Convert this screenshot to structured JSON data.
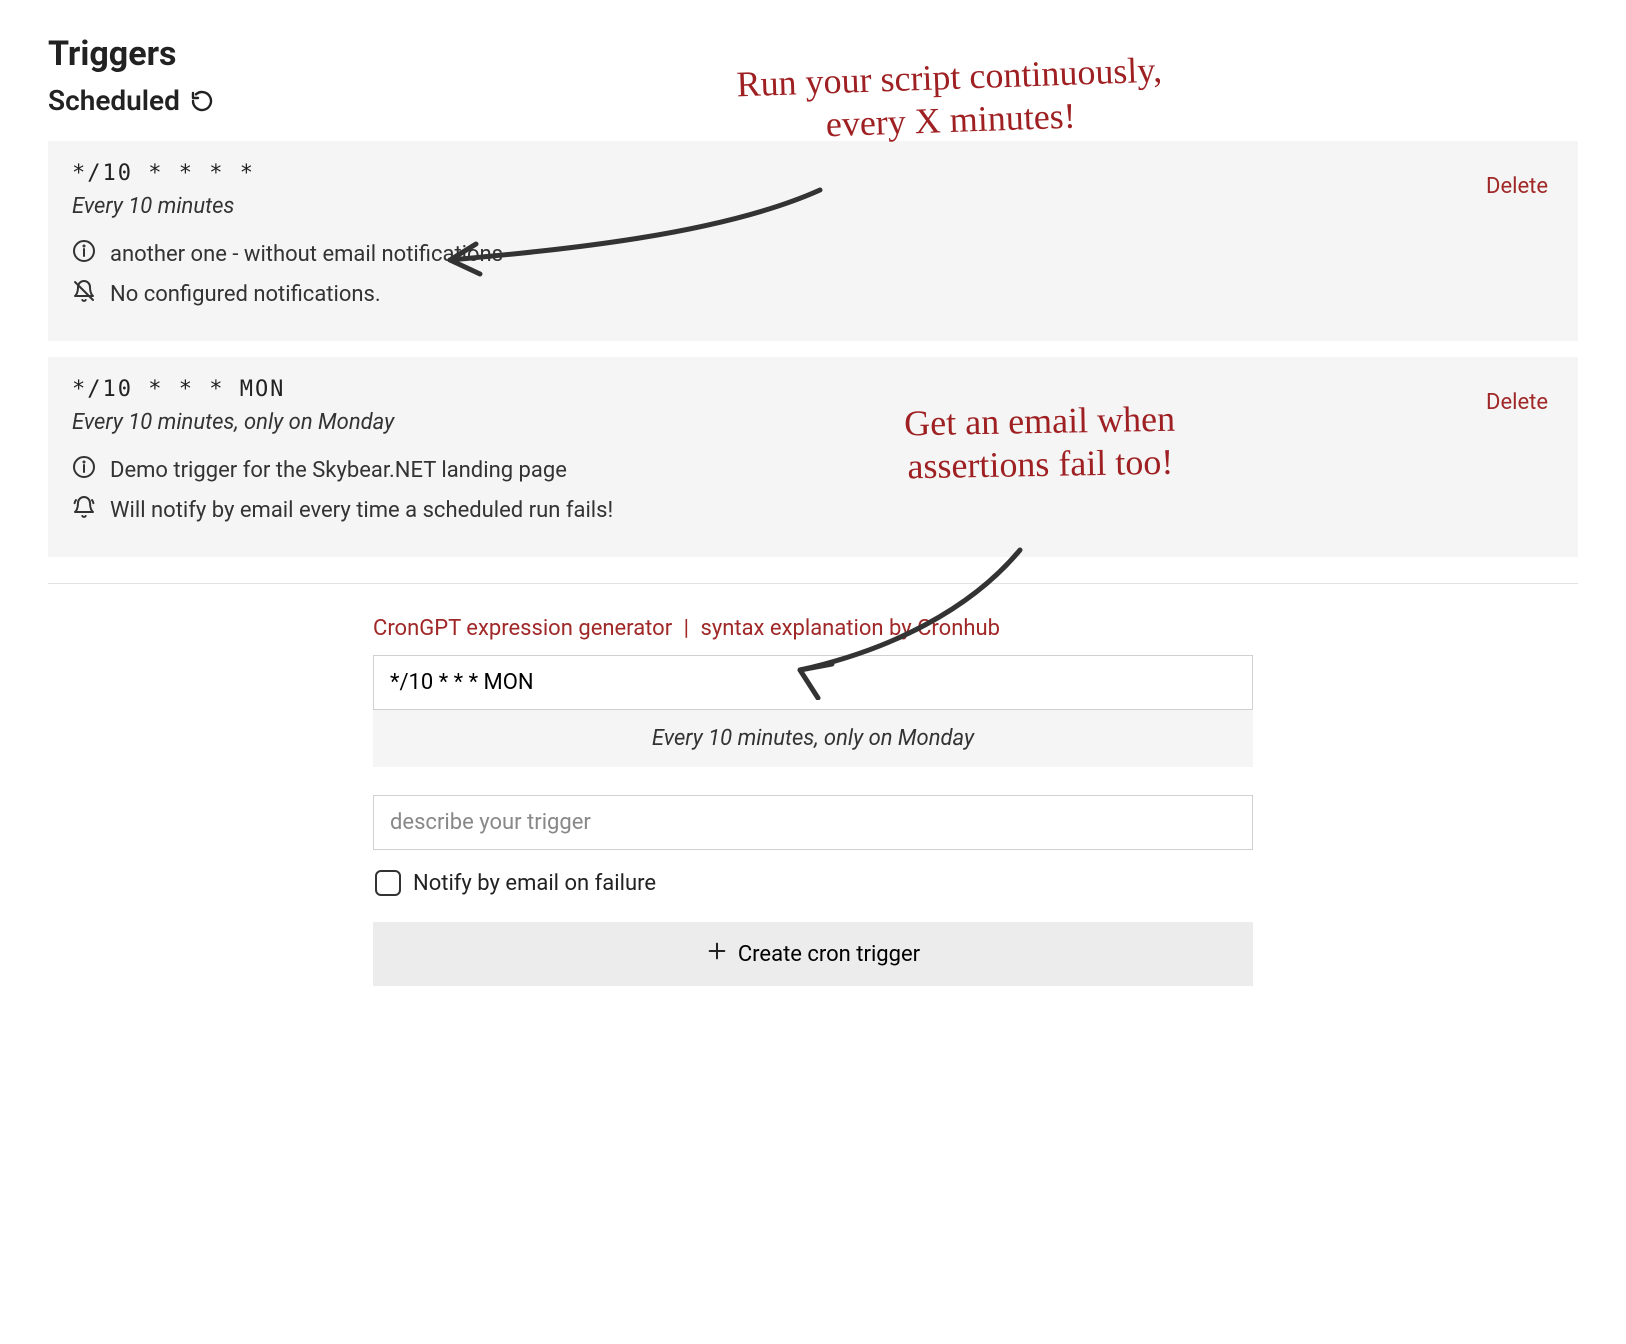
{
  "title": "Triggers",
  "section": {
    "heading": "Scheduled"
  },
  "triggers": [
    {
      "cron": "*/10 * * * *",
      "description": "Every 10 minutes",
      "info": "another one - without email notifications",
      "notify": "No configured notifications.",
      "delete_label": "Delete",
      "bell_off": true
    },
    {
      "cron": "*/10 * * * MON",
      "description": "Every 10 minutes, only on Monday",
      "info": "Demo trigger for the Skybear.NET landing page",
      "notify": "Will notify by email every time a scheduled run fails!",
      "delete_label": "Delete",
      "bell_off": false
    }
  ],
  "form": {
    "link_crongpt": "CronGPT expression generator",
    "link_cronhub": "syntax explanation by Cronhub",
    "cron_value": "*/10 * * * MON",
    "cron_preview": "Every 10 minutes, only on Monday",
    "describe_placeholder": "describe your trigger",
    "notify_label": "Notify by email on failure",
    "create_label": "Create cron trigger"
  },
  "annotations": {
    "line1": "Run your script continuously,\n   every X minutes!",
    "line2": "Get an email when\nassertions fail too!"
  },
  "colors": {
    "accent": "#a12828"
  }
}
